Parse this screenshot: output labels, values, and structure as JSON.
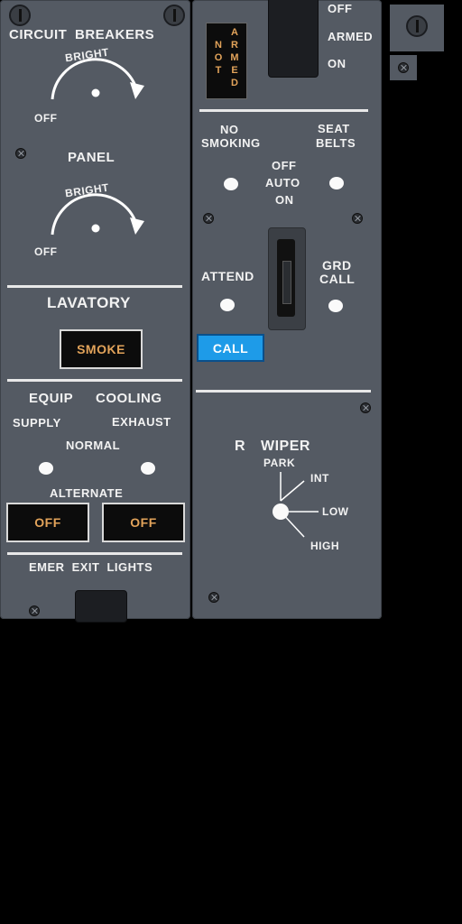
{
  "left_panel": {
    "circuit_breakers": {
      "title": "CIRCUIT BREAKERS",
      "bright": "BRIGHT",
      "off": "OFF"
    },
    "panel_knob": {
      "title": "PANEL",
      "bright": "BRIGHT",
      "off": "OFF"
    },
    "lavatory": {
      "title": "LAVATORY",
      "smoke": "SMOKE"
    },
    "equip_cooling": {
      "title_left": "EQUIP",
      "title_right": "COOLING",
      "supply": "SUPPLY",
      "exhaust": "EXHAUST",
      "normal": "NORMAL",
      "alternate": "ALTERNATE",
      "supply_off": "OFF",
      "exhaust_off": "OFF"
    },
    "emer_exit": {
      "w1": "EMER",
      "w2": "EXIT",
      "w3": "LIGHTS"
    }
  },
  "right_panel": {
    "emer_exit_switch": {
      "off": "OFF",
      "armed": "ARMED",
      "on": "ON",
      "not_letters": "NOT",
      "armed_letters": "ARMED"
    },
    "signs": {
      "no_smoking_1": "NO",
      "no_smoking_2": "SMOKING",
      "seat_belts_1": "SEAT",
      "seat_belts_2": "BELTS",
      "off": "OFF",
      "auto": "AUTO",
      "on": "ON"
    },
    "attend": {
      "attend": "ATTEND",
      "grd_1": "GRD",
      "grd_2": "CALL",
      "call": "CALL"
    },
    "wiper": {
      "side": "R",
      "title": "WIPER",
      "park": "PARK",
      "int": "INT",
      "low": "LOW",
      "high": "HIGH"
    }
  },
  "colors": {
    "panel": "#545a63",
    "amber": "#e2a35a",
    "call_blue": "#1e9be8"
  }
}
